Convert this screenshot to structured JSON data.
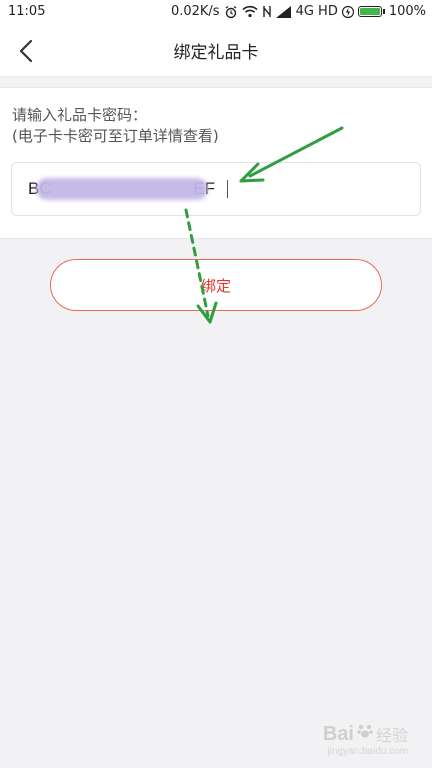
{
  "status_bar": {
    "time": "11:05",
    "network_speed": "0.02K/s",
    "network_type": "4G HD",
    "battery_percent": "100%",
    "battery_level": 1.0,
    "icons": [
      "alarm-icon",
      "wifi-icon",
      "nfc-icon",
      "signal-icon",
      "charging-icon",
      "battery-icon"
    ]
  },
  "nav": {
    "title": "绑定礼品卡",
    "back_icon": "chevron-left-icon"
  },
  "form": {
    "prompt_line1": "请输入礼品卡密码：",
    "prompt_line2": "(电子卡卡密可至订单详情查看)",
    "card_code_value": "BC                              EF"
  },
  "actions": {
    "bind_label": "绑定"
  },
  "watermark": {
    "logo_text": "Bai",
    "suffix": "经验",
    "url": "jingyan.baidu.com"
  },
  "colors": {
    "accent_red": "#e2342a",
    "arrow_green": "#2e9e3f",
    "battery_green": "#43b649",
    "blur_purple": "#c3b7e6"
  }
}
